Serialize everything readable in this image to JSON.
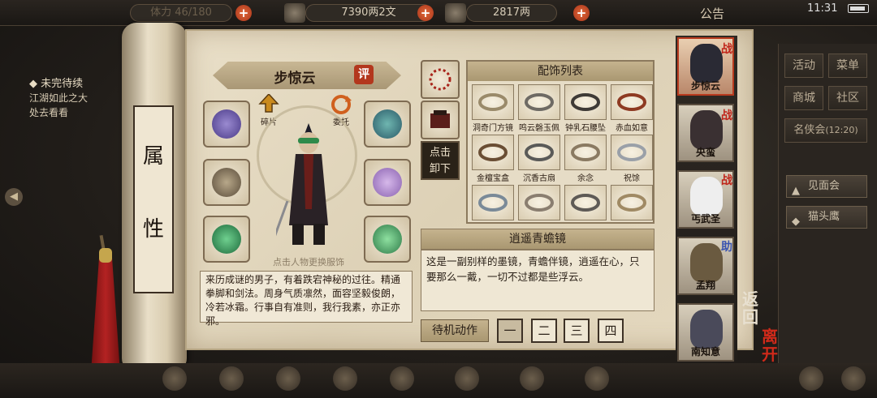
{
  "topbar": {
    "bag_label": "体力 46/180",
    "silver_value": "7390两2文",
    "gold_value": "2817两",
    "notice_label": "公告",
    "clock": "11:31"
  },
  "quest": {
    "title": "未完待续",
    "line1": "江湖如此之大",
    "line2": "处去看看"
  },
  "scroll": {
    "char1": "属",
    "char2": "性"
  },
  "character": {
    "name": "步惊云",
    "rate_label": "评",
    "action_fragment": "碎片",
    "action_entrust": "委托",
    "hint": "点击人物更换服饰",
    "bio": "来历成谜的男子，有着跌宕神秘的过往。精通拳脚和剑法。周身气质凛然，面容坚毅俊朗，冷若冰霜。行事自有准则，我行我素，亦正亦邪。"
  },
  "unequip": {
    "line1": "点击",
    "line2": "卸下"
  },
  "accessories": {
    "header": "配饰列表",
    "items": [
      {
        "label": "洞奇门方镜",
        "color": "#9a8a6a"
      },
      {
        "label": "鸣云磬玉佩",
        "color": "#6e6a64"
      },
      {
        "label": "钟乳石腰坠",
        "color": "#3e3a36"
      },
      {
        "label": "赤血如意",
        "color": "#8e3a22"
      },
      {
        "label": "金檀宝盒",
        "color": "#6a4e34"
      },
      {
        "label": "沉香古扇",
        "color": "#5a5a58"
      },
      {
        "label": "余念",
        "color": "#8a7a62"
      },
      {
        "label": "祝馀",
        "color": "#9aa0a8"
      },
      {
        "label": "",
        "color": "#7a8a98"
      },
      {
        "label": "",
        "color": "#8a7e70"
      },
      {
        "label": "",
        "color": "#5e5a56"
      },
      {
        "label": "",
        "color": "#a08a64"
      }
    ]
  },
  "description": {
    "title": "逍遥青蟾镜",
    "text": "这是一副别样的墨镜，青蟾伴镜，逍遥在心，只要那么一戴，一切不过都是些浮云。"
  },
  "idle": {
    "label": "待机动作",
    "b1": "一",
    "b2": "二",
    "b3": "三",
    "b4": "四"
  },
  "roster": [
    {
      "name": "步惊云",
      "tag": "战"
    },
    {
      "name": "央蛮",
      "tag": "战"
    },
    {
      "name": "丐武圣",
      "tag": "战"
    },
    {
      "name": "孟翔",
      "tag": "助"
    },
    {
      "name": "南知意",
      "tag": ""
    }
  ],
  "side_buttons": {
    "back": "返回",
    "leave": "离开"
  },
  "right_menu": {
    "activity": "活动",
    "menu": "菜单",
    "shop": "商城",
    "community": "社区",
    "fame": "名侠会",
    "fame_time": "(12:20)",
    "meet": "见面会",
    "owl": "猫头鹰"
  },
  "colors": {
    "accent_red": "#b3371d",
    "parchment": "#e9dfc8"
  }
}
